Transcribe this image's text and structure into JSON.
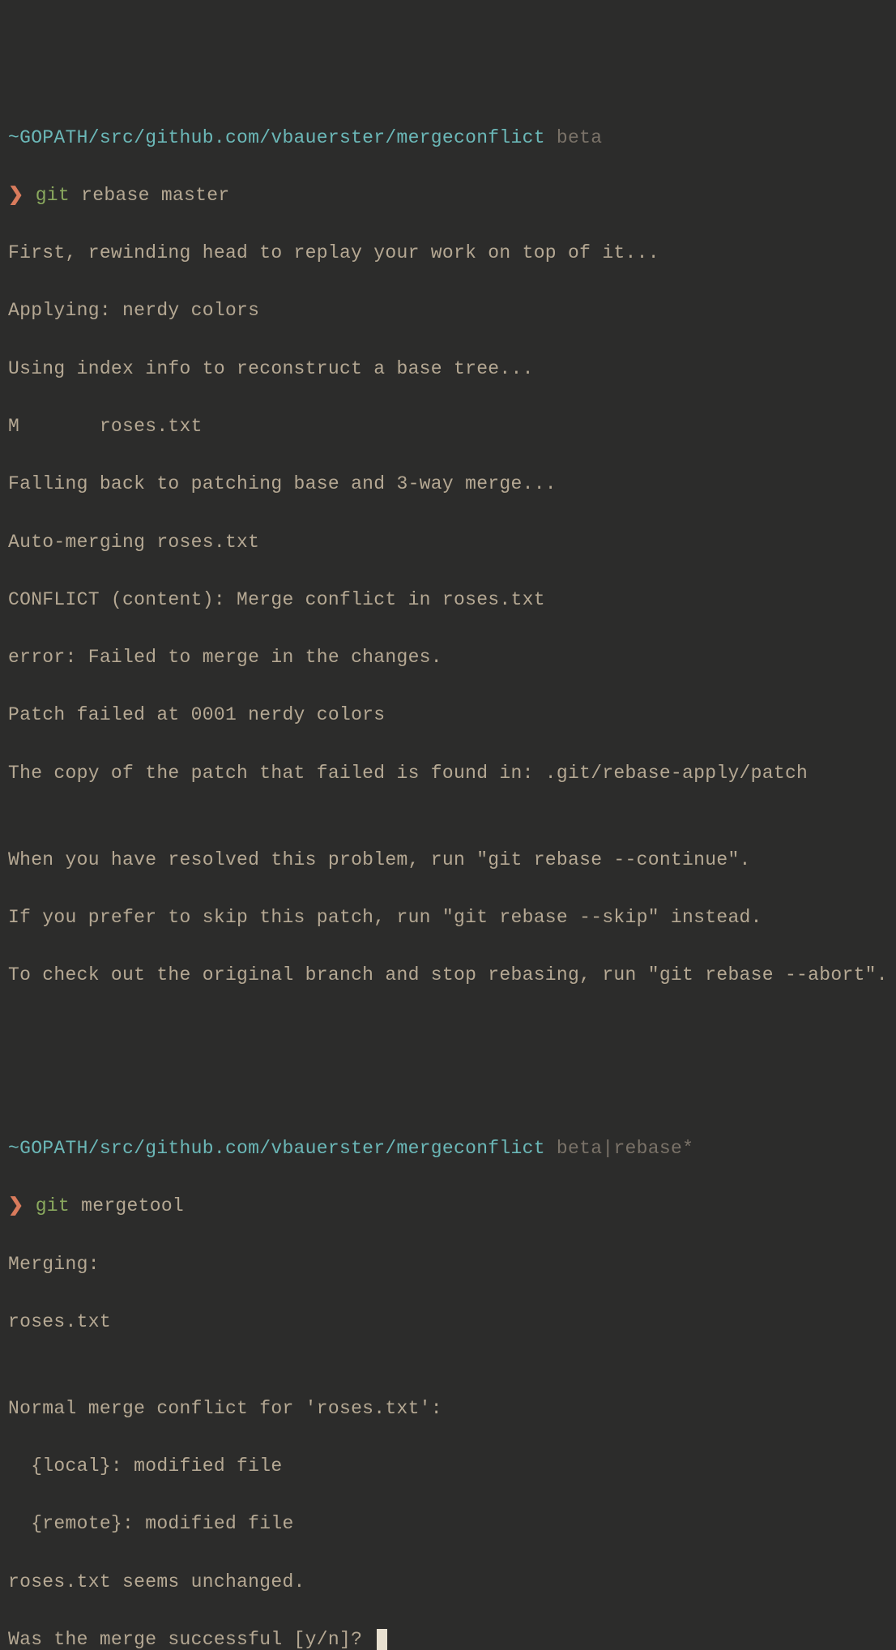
{
  "prompt1": {
    "path": "~GOPATH/src/github.com/vbauerster/mergeconflict",
    "branch": "beta",
    "symbol": "❯",
    "git": "git",
    "args": "rebase master"
  },
  "output1": {
    "l1": "First, rewinding head to replay your work on top of it...",
    "l2": "Applying: nerdy colors",
    "l3": "Using index info to reconstruct a base tree...",
    "l4": "M       roses.txt",
    "l5": "Falling back to patching base and 3-way merge...",
    "l6": "Auto-merging roses.txt",
    "l7": "CONFLICT (content): Merge conflict in roses.txt",
    "l8": "error: Failed to merge in the changes.",
    "l9": "Patch failed at 0001 nerdy colors",
    "l10": "The copy of the patch that failed is found in: .git/rebase-apply/patch",
    "l11": "",
    "l12": "When you have resolved this problem, run \"git rebase --continue\".",
    "l13": "If you prefer to skip this patch, run \"git rebase --skip\" instead.",
    "l14": "To check out the original branch and stop rebasing, run \"git rebase --abort\"."
  },
  "prompt2": {
    "path": "~GOPATH/src/github.com/vbauerster/mergeconflict",
    "branch": "beta",
    "sep": "|",
    "state": "rebase*",
    "symbol": "❯",
    "git": "git",
    "args": "mergetool"
  },
  "output2": {
    "l1": "Merging:",
    "l2": "roses.txt",
    "l3": "",
    "l4": "Normal merge conflict for 'roses.txt':",
    "l5": "  {local}: modified file",
    "l6": "  {remote}: modified file",
    "l7": "roses.txt seems unchanged.",
    "l8": "Was the merge successful [y/n]? "
  }
}
